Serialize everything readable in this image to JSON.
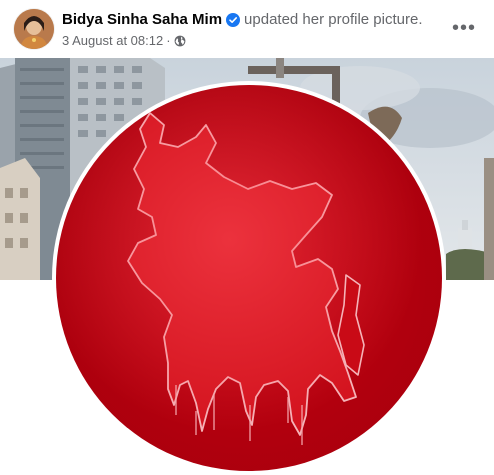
{
  "post": {
    "author": "Bidya Sinha Saha Mim",
    "action": "updated her profile picture.",
    "timestamp": "3 August at 08:12",
    "separator": "·",
    "more_label": "•••",
    "privacy_icon": "globe-icon",
    "verified_icon": "verified-badge-icon"
  },
  "colors": {
    "verified_blue": "#1877f2",
    "profile_red": "#b5000f",
    "meta_gray": "#65676b"
  }
}
